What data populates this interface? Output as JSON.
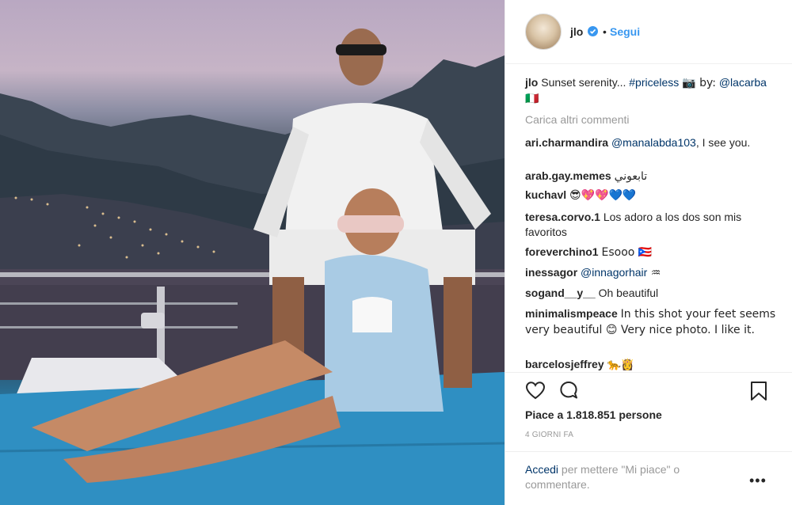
{
  "post": {
    "author": "jlo",
    "follow_label": "Segui",
    "separator": "•",
    "caption_user": "jlo",
    "caption_text": "Sunset serenity...",
    "caption_hashtag": "#priceless",
    "caption_by": "📷 by:",
    "caption_mention": "@lacarba",
    "caption_flag": "🇮🇹",
    "load_more": "Carica altri commenti",
    "likes": "Piace a 1.818.851 persone",
    "time": "4 GIORNI FA",
    "login_link": "Accedi",
    "login_text": "per mettere \"Mi piace\" o commentare.",
    "more_options": "•••"
  },
  "comments": [
    {
      "user": "ari.charmandira",
      "mention": "@manalabda103",
      "text": ", I see you."
    },
    {
      "user": "arab.gay.memes",
      "mention": "",
      "text": "تابعوني"
    },
    {
      "user": "kuchavl",
      "mention": "",
      "text": "😎💖💖💙💙"
    },
    {
      "user": "teresa.corvo.1",
      "mention": "",
      "text": "Los adoro a los dos son mis favoritos"
    },
    {
      "user": "foreverchino1",
      "mention": "",
      "text": "Esooo 🇵🇷"
    },
    {
      "user": "inessagor",
      "mention": "@innagorhair",
      "text": " ♒"
    },
    {
      "user": "sogand__y__",
      "mention": "",
      "text": "Oh beautiful"
    },
    {
      "user": "minimalismpeace",
      "mention": "",
      "text": "In this shot your feet seems very beautiful 😊 Very nice photo. I like it."
    },
    {
      "user": "barcelosjeffrey",
      "mention": "",
      "text": "🐆👸"
    }
  ],
  "icons": {
    "like": "heart-icon",
    "comment": "comment-bubble-icon",
    "save": "bookmark-icon",
    "verified": "verified-badge-icon"
  },
  "colors": {
    "link": "#003569",
    "follow": "#3897f0",
    "muted": "#999999",
    "text": "#262626"
  }
}
